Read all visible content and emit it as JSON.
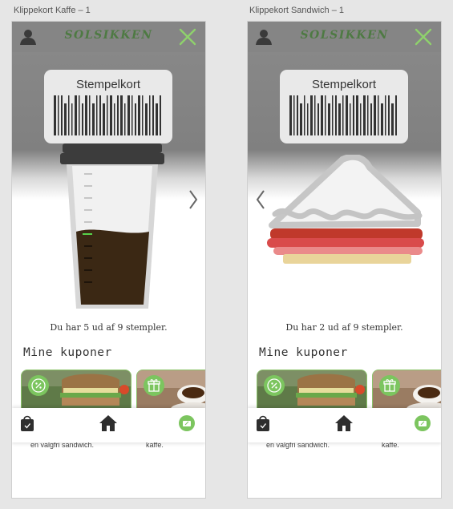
{
  "artboards": [
    {
      "title": "Klippekort Kaffe – 1",
      "logo": "SOLSIKKEN",
      "card_title": "Stempelkort",
      "stamp_text": "Du har 5 ud af 9 stempler.",
      "stamps_collected": 5,
      "stamps_total": 9,
      "coupons_title": "Mine kuponer",
      "coupon_captions": [
        "en valgfri sandwich.",
        "kaffe."
      ]
    },
    {
      "title": "Klippekort Sandwich – 1",
      "logo": "SOLSIKKEN",
      "card_title": "Stempelkort",
      "stamp_text": "Du har 2 ud af 9 stempler.",
      "stamps_collected": 2,
      "stamps_total": 9,
      "coupons_title": "Mine kuponer",
      "coupon_captions": [
        "en valgfri sandwich.",
        "kaffe."
      ]
    }
  ],
  "colors": {
    "brand_green": "#7cc55f",
    "logo_green": "#4e7a43",
    "header_gray": "#858585",
    "coffee_brown": "#3b2814",
    "coupon_border": "#8bc46a"
  },
  "icons": {
    "header_left": "user-icon",
    "header_right": "close-icon",
    "coupon_badges": [
      "percent-badge-icon",
      "gift-badge-icon"
    ],
    "tabbar": [
      "shopping-bag-icon",
      "home-icon",
      "coupon-icon"
    ]
  }
}
